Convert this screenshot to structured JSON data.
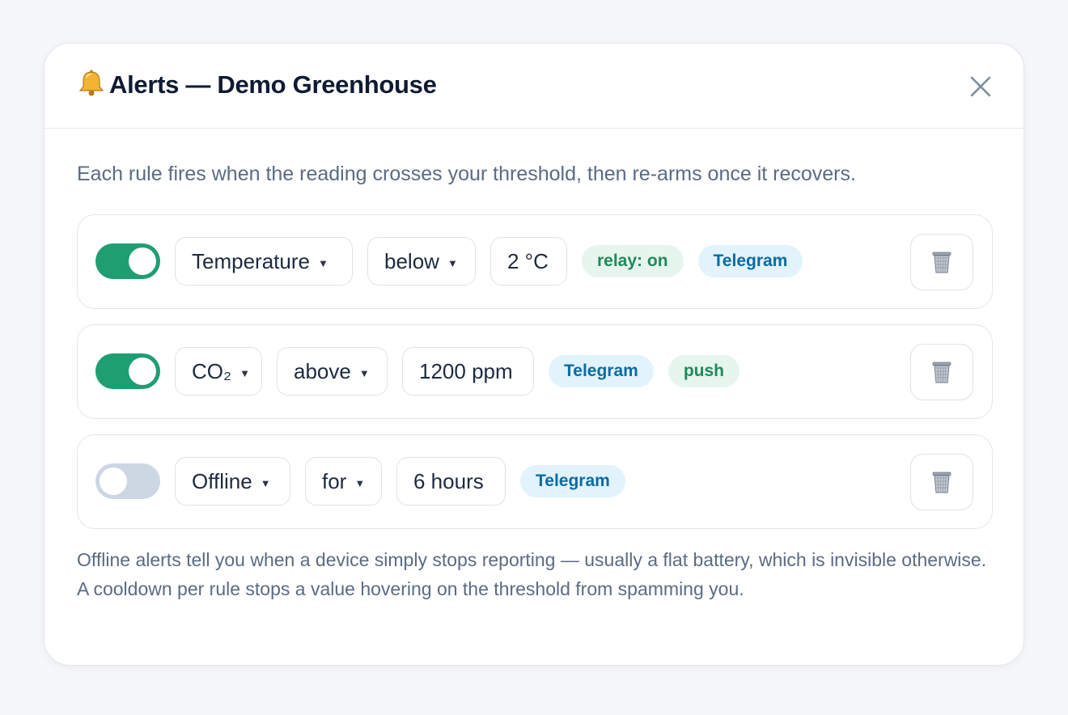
{
  "modal": {
    "title": "Alerts — Demo Greenhouse",
    "title_icon": "bell-icon",
    "close_icon": "close-icon",
    "intro": "Each rule fires when the reading crosses your threshold, then re-arms once it recovers.",
    "footer_note": "Offline alerts tell you when a device simply stops reporting — usually a flat battery, which is invisible otherwise. A cooldown per rule stops a value hovering on the threshold from spamming you."
  },
  "rules": [
    {
      "enabled": true,
      "metric": "Temperature",
      "condition": "below",
      "threshold": "2 °C",
      "actions": [
        {
          "label": "relay: on",
          "color": "green"
        },
        {
          "label": "Telegram",
          "color": "blue"
        }
      ]
    },
    {
      "enabled": true,
      "metric": "CO₂",
      "condition": "above",
      "threshold": "1200 ppm",
      "actions": [
        {
          "label": "Telegram",
          "color": "blue"
        },
        {
          "label": "push",
          "color": "green"
        }
      ]
    },
    {
      "enabled": false,
      "metric": "Offline",
      "condition": "for",
      "threshold": "6 hours",
      "actions": [
        {
          "label": "Telegram",
          "color": "blue"
        }
      ]
    }
  ],
  "colors": {
    "toggle_on": "#1f9e72",
    "toggle_off": "#cdd7e3",
    "chip_green_bg": "#e6f5ee",
    "chip_green_text": "#1f8a5c",
    "chip_blue_bg": "#e2f3fb",
    "chip_blue_text": "#0b6ba3"
  }
}
